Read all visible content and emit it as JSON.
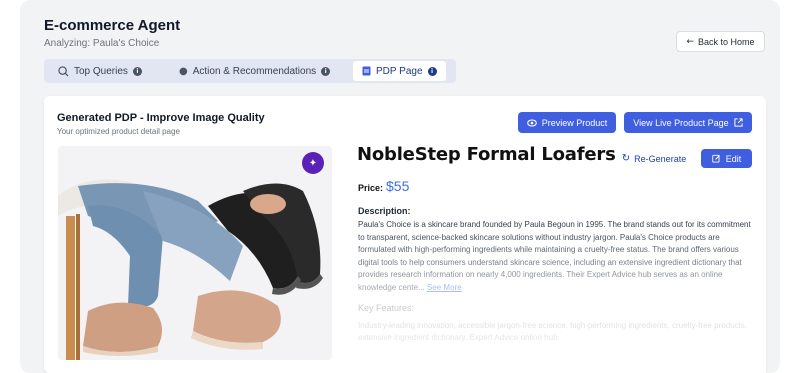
{
  "header": {
    "title": "E-commerce Agent",
    "subtitle": "Analyzing: Paula's Choice",
    "back_label": "Back to Home",
    "back_icon": "arrow-left-icon"
  },
  "tabs": [
    {
      "label": "Top Queries",
      "icon": "search-chart-icon",
      "active": false
    },
    {
      "label": "Action & Recommendations",
      "icon": "lightbulb-icon",
      "active": false
    },
    {
      "label": "PDP Page",
      "icon": "document-icon",
      "active": true
    }
  ],
  "card": {
    "title": "Generated PDP - Improve Image Quality",
    "subtitle": "Your optimized product detail page",
    "preview_label": "Preview Product",
    "live_label": "View Live Product Page"
  },
  "product": {
    "name": "NobleStep Formal Loafers",
    "regenerate_label": "Re-Generate",
    "edit_label": "Edit",
    "price_label": "Price:",
    "price": "$55",
    "description_label": "Description:",
    "description": "Paula's Choice is a skincare brand founded by Paula Begoun in 1995. The brand stands out for its commitment to transparent, science-backed skincare solutions without industry jargon. Paula's Choice products are formulated with high-performing ingredients while maintaining a cruelty-free status. The brand offers various digital tools to help consumers understand skincare science, including an extensive ingredient dictionary that provides research information on nearly 4,000 ingredients. Their Expert Advice hub serves as an online knowledge cente...",
    "see_more": "See More",
    "features_label": "Key Features:",
    "features": "Industry-leading innovation, accessible jargon-free science, high-performing ingredients, cruelty-free products, extensive ingredient dictionary, Expert Advice online hub"
  },
  "colors": {
    "accent": "#3f5fe0",
    "price": "#3b6fe0",
    "sparkle": "#5b21b6"
  }
}
